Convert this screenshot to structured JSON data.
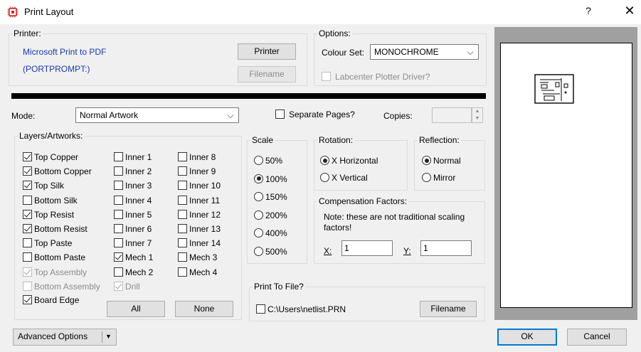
{
  "window": {
    "title": "Print Layout",
    "help": "?",
    "close": "✕"
  },
  "printer": {
    "legend": "Printer:",
    "name": "Microsoft Print to PDF",
    "port": "(PORTPROMPT:)",
    "printer_button": "Printer",
    "filename_button": "Filename"
  },
  "options": {
    "legend": "Options:",
    "colour_set_label": "Colour Set:",
    "colour_set_value": "MONOCHROME",
    "plotter_driver_label": "Labcenter Plotter Driver?"
  },
  "mode": {
    "label": "Mode:",
    "value": "Normal Artwork"
  },
  "separate_pages_label": "Separate Pages?",
  "copies": {
    "label": "Copies:",
    "value": ""
  },
  "layers": {
    "legend": "Layers/Artworks:",
    "col1": [
      {
        "label": "Top Copper",
        "checked": true,
        "disabled": false
      },
      {
        "label": "Bottom Copper",
        "checked": true,
        "disabled": false
      },
      {
        "label": "Top Silk",
        "checked": true,
        "disabled": false
      },
      {
        "label": "Bottom Silk",
        "checked": false,
        "disabled": false
      },
      {
        "label": "Top Resist",
        "checked": true,
        "disabled": false
      },
      {
        "label": "Bottom Resist",
        "checked": true,
        "disabled": false
      },
      {
        "label": "Top Paste",
        "checked": false,
        "disabled": false
      },
      {
        "label": "Bottom Paste",
        "checked": false,
        "disabled": false
      },
      {
        "label": "Top Assembly",
        "checked": true,
        "disabled": true
      },
      {
        "label": "Bottom Assembly",
        "checked": false,
        "disabled": true
      },
      {
        "label": "Board Edge",
        "checked": true,
        "disabled": false
      }
    ],
    "col2": [
      {
        "label": "Inner 1",
        "checked": false,
        "disabled": false
      },
      {
        "label": "Inner 2",
        "checked": false,
        "disabled": false
      },
      {
        "label": "Inner 3",
        "checked": false,
        "disabled": false
      },
      {
        "label": "Inner 4",
        "checked": false,
        "disabled": false
      },
      {
        "label": "Inner 5",
        "checked": false,
        "disabled": false
      },
      {
        "label": "Inner 6",
        "checked": false,
        "disabled": false
      },
      {
        "label": "Inner 7",
        "checked": false,
        "disabled": false
      },
      {
        "label": "Mech 1",
        "checked": true,
        "disabled": false
      },
      {
        "label": "Mech 2",
        "checked": false,
        "disabled": false
      },
      {
        "label": "Drill",
        "checked": true,
        "disabled": true
      }
    ],
    "col3": [
      {
        "label": "Inner 8",
        "checked": false,
        "disabled": false
      },
      {
        "label": "Inner 9",
        "checked": false,
        "disabled": false
      },
      {
        "label": "Inner 10",
        "checked": false,
        "disabled": false
      },
      {
        "label": "Inner 11",
        "checked": false,
        "disabled": false
      },
      {
        "label": "Inner 12",
        "checked": false,
        "disabled": false
      },
      {
        "label": "Inner 13",
        "checked": false,
        "disabled": false
      },
      {
        "label": "Inner 14",
        "checked": false,
        "disabled": false
      },
      {
        "label": "Mech 3",
        "checked": false,
        "disabled": false
      },
      {
        "label": "Mech 4",
        "checked": false,
        "disabled": false
      }
    ],
    "all_button": "All",
    "none_button": "None"
  },
  "scale": {
    "legend": "Scale",
    "options": [
      {
        "label": "50%",
        "selected": false
      },
      {
        "label": "100%",
        "selected": true
      },
      {
        "label": "150%",
        "selected": false
      },
      {
        "label": "200%",
        "selected": false
      },
      {
        "label": "400%",
        "selected": false
      },
      {
        "label": "500%",
        "selected": false
      }
    ]
  },
  "rotation": {
    "legend": "Rotation:",
    "options": [
      {
        "label": "X Horizontal",
        "selected": true
      },
      {
        "label": "X Vertical",
        "selected": false
      }
    ]
  },
  "reflection": {
    "legend": "Reflection:",
    "options": [
      {
        "label": "Normal",
        "selected": true
      },
      {
        "label": "Mirror",
        "selected": false
      }
    ]
  },
  "compensation": {
    "legend": "Compensation Factors:",
    "note": "Note: these are not traditional scaling factors!",
    "x_label": "X:",
    "x_value": "1",
    "y_label": "Y:",
    "y_value": "1"
  },
  "print_to_file": {
    "legend": "Print To File?",
    "path": "C:\\Users\\netlist.PRN",
    "checked": false,
    "filename_button": "Filename"
  },
  "advanced_options_button": "Advanced Options",
  "ok_button": "OK",
  "cancel_button": "Cancel"
}
